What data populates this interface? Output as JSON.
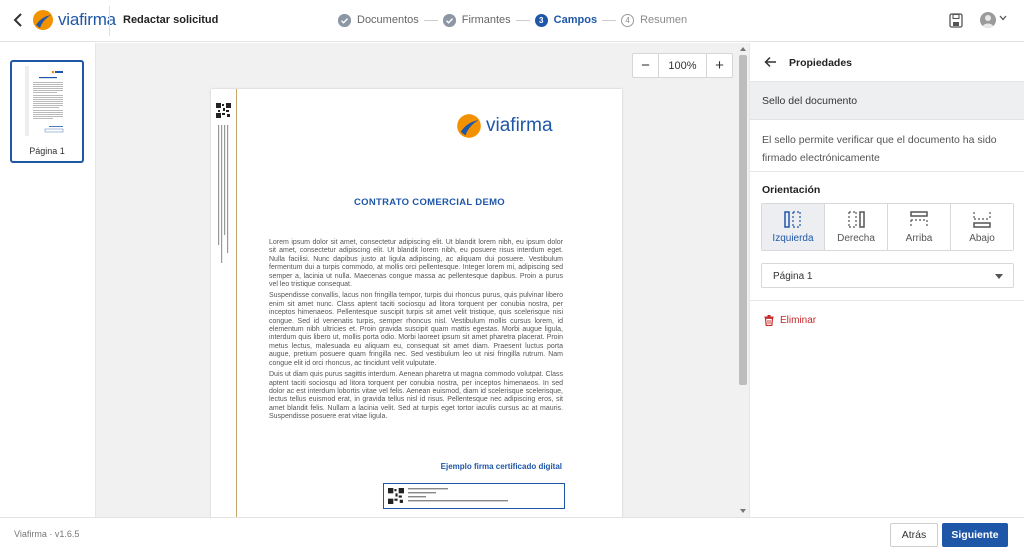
{
  "app": {
    "brand": "viafirma",
    "page_title": "Redactar solicitud"
  },
  "steps": [
    {
      "label": "Documentos",
      "state": "done",
      "number": ""
    },
    {
      "label": "Firmantes",
      "state": "done",
      "number": ""
    },
    {
      "label": "Campos",
      "state": "active",
      "number": "3"
    },
    {
      "label": "Resumen",
      "state": "todo",
      "number": "4"
    }
  ],
  "thumbnails": {
    "pages": [
      {
        "label": "Página 1",
        "selected": true
      }
    ]
  },
  "zoom": {
    "minus": "−",
    "value": "100%",
    "plus": "+"
  },
  "document": {
    "logo_text": "viafirma",
    "title": "CONTRATO COMERCIAL DEMO",
    "paragraphs": [
      "Lorem ipsum dolor sit amet, consectetur adipiscing elit. Ut blandit lorem nibh, eu ipsum dolor sit amet, consectetur adipiscing elit. Ut blandit lorem nibh, eu posuere risus interdum eget. Nulla facilisi. Nunc dapibus justo at ligula adipiscing, ac aliquam dui posuere. Vestibulum fermentum dui a turpis commodo, at mollis orci pellentesque. Integer lorem mi, adipiscing sed semper a, lacinia ut nulla. Maecenas congue massa ac pellentesque dapibus. Proin a purus vel leo tristique consequat.",
      "Suspendisse convallis, lacus non fringilla tempor, turpis dui rhoncus purus, quis pulvinar libero enim sit amet nunc. Class aptent taciti sociosqu ad litora torquent per conubia nostra, per inceptos himenaeos. Pellentesque suscipit turpis sit amet velit tristique, quis scelerisque nisi congue. Sed id venenatis turpis, semper rhoncus nisl. Vestibulum mollis cursus lorem, id elementum nibh ultricies et. Proin gravida suscipit quam mattis egestas. Morbi augue ligula, interdum quis libero ut, mollis porta odio. Morbi laoreet ipsum sit amet pharetra placerat. Proin metus lectus, malesuada eu aliquam eu, consequat sit amet diam. Praesent luctus porta augue, pretium posuere quam fringilla nec. Sed vestibulum leo ut nisi fringilla rutrum. Nam congue elit id orci rhoncus, ac tincidunt velit vulputate.",
      "Duis ut diam quis purus sagittis interdum. Aenean pharetra ut magna commodo volutpat. Class aptent taciti sociosqu ad litora torquent per conubia nostra, per inceptos himenaeos. In sed dolor ac est interdum lobortis vitae vel felis. Aenean euismod, diam id scelerisque scelerisque, lectus tellus euismod erat, in gravida tellus nisl id risus. Pellentesque nec adipiscing eros, sit amet blandit felis. Nullam a lacinia velit. Sed at turpis eget tortor iaculis cursus ac at mauris. Suspendisse posuere erat vitae ligula."
    ],
    "signature_label": "Ejemplo firma certificado digital"
  },
  "panel": {
    "title": "Propiedades",
    "section_title": "Sello del documento",
    "description": "El sello permite verificar que el documento ha sido firmado electrónicamente",
    "orientation_label": "Orientación",
    "orientations": [
      {
        "label": "Izquierda",
        "active": true
      },
      {
        "label": "Derecha",
        "active": false
      },
      {
        "label": "Arriba",
        "active": false
      },
      {
        "label": "Abajo",
        "active": false
      }
    ],
    "page_select_value": "Página 1",
    "delete_label": "Eliminar"
  },
  "footer": {
    "version": "Viafirma  ·  v1.6.5",
    "back_label": "Atrás",
    "next_label": "Siguiente"
  },
  "colors": {
    "brand_blue": "#1f57a8",
    "brand_orange": "#f39200",
    "danger": "#c62828"
  },
  "icons": {
    "back": "chevron-left-icon",
    "save": "save-icon",
    "user": "user-avatar-icon",
    "delete": "trash-icon",
    "step_done": "check-circle-icon"
  }
}
